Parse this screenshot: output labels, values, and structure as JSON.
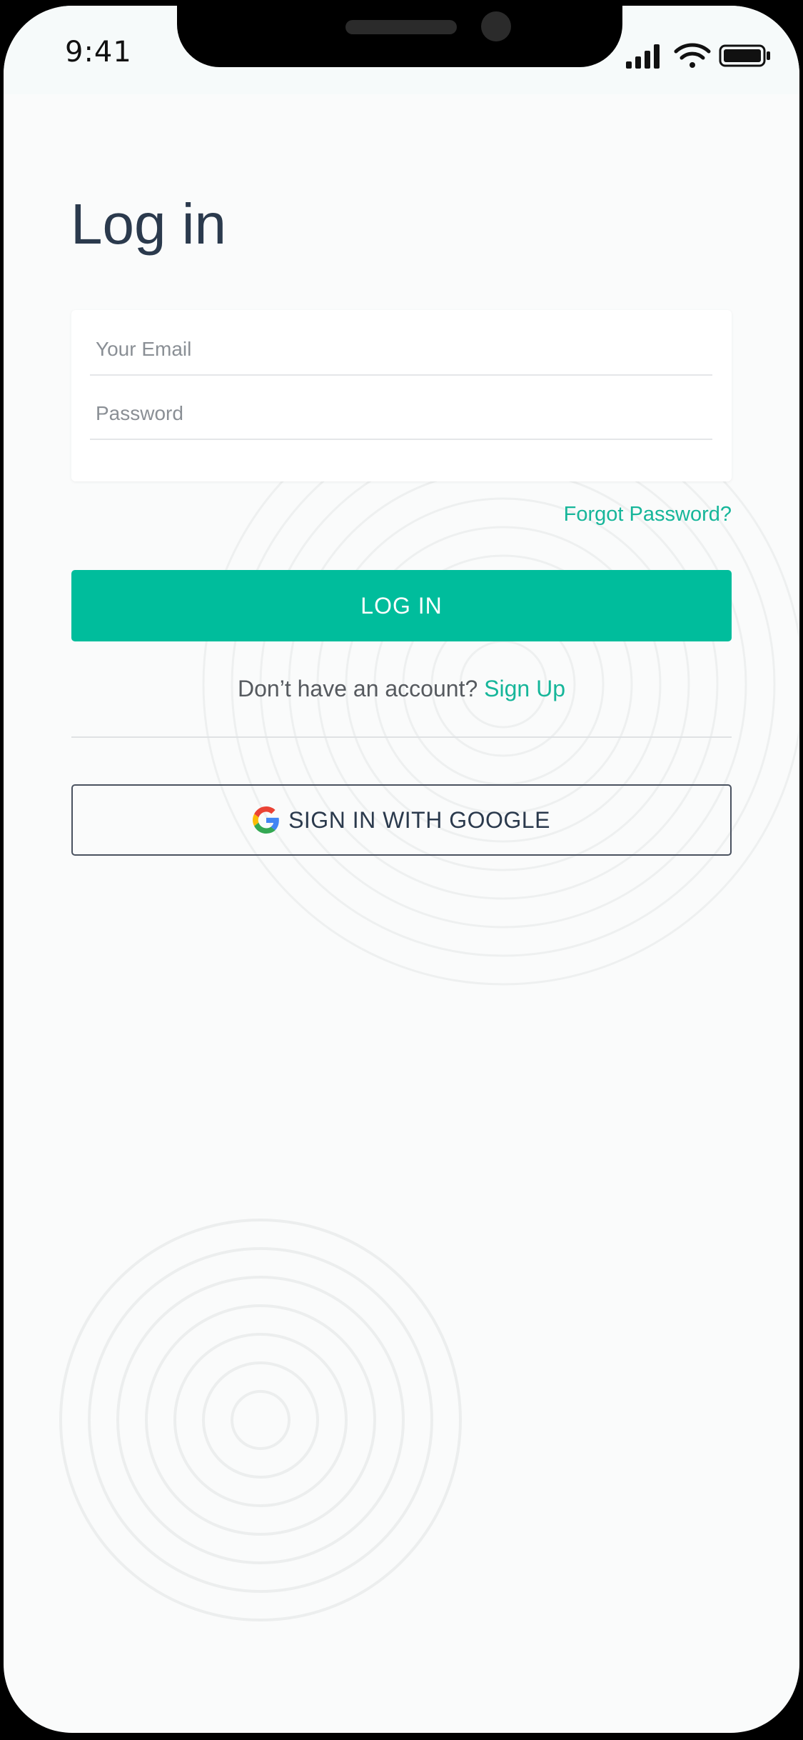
{
  "status_bar": {
    "time": "9:41"
  },
  "login": {
    "title": "Log in",
    "email_placeholder": "Your Email",
    "password_placeholder": "Password",
    "forgot_password": "Forgot Password?",
    "login_button": "LOG IN",
    "no_account_text": "Don’t have an account?",
    "sign_up_link": "Sign Up",
    "google_button": "SIGN IN WITH GOOGLE"
  },
  "colors": {
    "accent": "#00bd9c",
    "link": "#16b69a",
    "title": "#2b3a4d"
  },
  "icons": [
    "cellular-signal-icon",
    "wifi-icon",
    "battery-icon",
    "google-icon"
  ]
}
